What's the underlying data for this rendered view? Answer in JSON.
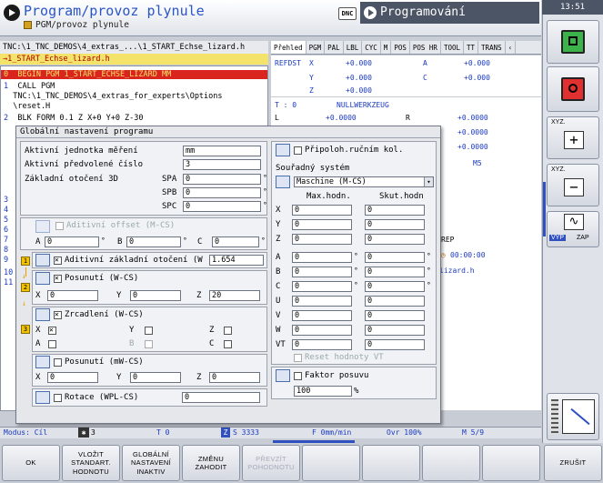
{
  "header": {
    "title": "Program/provoz plynule",
    "subtitle": "PGM/provoz plynule",
    "dnc": "DNC",
    "mode": "Programování",
    "clock": "13:51"
  },
  "program": {
    "path": "TNC:\\1_TNC_DEMOS\\4_extras_...\\1_START_Echse_lizard.h",
    "file_tab": "→1_START_Echse_lizard.h",
    "lines": [
      {
        "num": "0",
        "text": "  BEGIN PGM 1_START_ECHSE_LIZARD MM"
      },
      {
        "num": "1",
        "text": "  CALL PGM"
      },
      {
        "num": "",
        "text": "  TNC:\\1_TNC_DEMOS\\4_extras_for_experts\\Options"
      },
      {
        "num": "",
        "text": "  \\reset.H"
      },
      {
        "num": "2",
        "text": "  BLK FORM 0.1 Z X+0 Y+0 Z-30"
      },
      {
        "num": "3",
        "text": ""
      },
      {
        "num": "4",
        "text": ""
      },
      {
        "num": "5",
        "text": ""
      },
      {
        "num": "6",
        "text": ""
      },
      {
        "num": "7",
        "text": ""
      },
      {
        "num": "8",
        "text": ""
      },
      {
        "num": "9",
        "text": ""
      },
      {
        "num": "10",
        "text": ""
      },
      {
        "num": "11",
        "text": ""
      }
    ]
  },
  "status_tabs": [
    "Přehled",
    "PGM",
    "PAL",
    "LBL",
    "CYC",
    "M",
    "POS",
    "POS HR",
    "TOOL",
    "TT",
    "TRANS"
  ],
  "status": {
    "refdst": "REFDST",
    "ax": [
      {
        "axis": "X",
        "val": "+0.000",
        "axis2": "A",
        "val2": "+0.000"
      },
      {
        "axis": "Y",
        "val": "+0.000",
        "axis2": "C",
        "val2": "+0.000"
      },
      {
        "axis": "Z",
        "val": "+0.000",
        "axis2": "",
        "val2": ""
      }
    ],
    "t_label": "T : 0",
    "t_name": "NULLWERKZEUG",
    "l_label": "L",
    "l_val": "+0.0000",
    "r_label": "R",
    "r_val": "+0.0000",
    "r2_val": "+0.0000",
    "r3_val": "+0.0000",
    "m_val": "M5",
    "rep": "REP",
    "time": "00:00:00",
    "file": "lizard.h"
  },
  "dialog": {
    "title": "Globální nastavení programu",
    "active_unit_label": "Aktivní jednotka měření",
    "active_unit": "mm",
    "active_preset_label": "Aktivní předvolené číslo",
    "active_preset": "3",
    "basic_rot_label": "Základní otočení 3D",
    "spa": "SPA",
    "spa_val": "0",
    "spb": "SPB",
    "spb_val": "0",
    "spc": "SPC",
    "spc_val": "0",
    "deg": "°",
    "add_offset": "Aditivní offset (M-CS)",
    "a": "A",
    "b": "B",
    "c": "C",
    "ofs_a": "0",
    "ofs_b": "0",
    "ofs_c": "0",
    "add_rot": "Aditivní základní otočení (W",
    "add_rot_val": "1.654",
    "shift": "Posunutí (W-CS)",
    "x": "X",
    "y": "Y",
    "z": "Z",
    "shift_x": "0",
    "shift_y": "0",
    "shift_z": "20",
    "mirror": "Zrcadlení (W-CS)",
    "shift_mw": "Posunutí (mW-CS)",
    "shift_mw_x": "0",
    "shift_mw_y": "0",
    "shift_mw_z": "0",
    "rot": "Rotace (WPL-CS)",
    "rot_val": "0",
    "handwheel": "Připoloh.ručním kol.",
    "coord_sys": "Souřadný systém",
    "coord_sel": "Maschine (M-CS)",
    "max_val": "Max.hodn.",
    "act_val": "Skut.hodn",
    "hw_axes": [
      "X",
      "Y",
      "Z",
      "A",
      "B",
      "C",
      "U",
      "V",
      "W"
    ],
    "hw_max": [
      "0",
      "0",
      "0",
      "0",
      "0",
      "0",
      "0",
      "0",
      "0"
    ],
    "hw_act": [
      "0",
      "0",
      "0",
      "0",
      "0",
      "0",
      "0",
      "0",
      "0"
    ],
    "vt": "VT",
    "vt_max": "0",
    "vt_act": "0",
    "reset_vt": "Reset hodnoty VT",
    "feed_factor": "Faktor posuvu",
    "feed_val": "100",
    "pct": "%",
    "n1": "1",
    "n2": "2",
    "n3": "3"
  },
  "bottom_status": {
    "mode": "Modus: Cíl",
    "tool_no": "3",
    "t": "T 0",
    "s": "S 3333",
    "f": "F 0mm/min",
    "ovr": "Ovr 100%",
    "m": "M 5/9"
  },
  "right_panel": {
    "xyz_plus_label": "XYZ.",
    "plus": "+",
    "xyz_minus_label": "XYZ.",
    "minus": "−",
    "vyp": "VYP",
    "zap": "ZAP",
    "wave": "∿"
  },
  "softkeys": {
    "ok": "OK",
    "load_std": "VLOŽIT STANDART. HODNOTU",
    "global_inactive": "GLOBÁLNÍ NASTAVENÍ INAKTIV",
    "discard": "ZMĚNU ZAHODIT",
    "check": "PŘEVZÍT POHODNOTU",
    "end": "ZRUŠIT"
  }
}
